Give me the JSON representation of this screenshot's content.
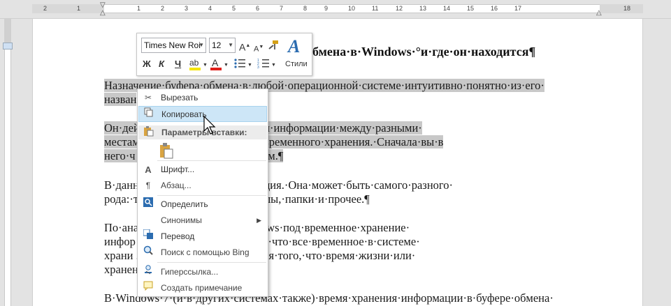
{
  "ruler": {
    "numbers": [
      "2",
      "1",
      "1",
      "2",
      "3",
      "4",
      "5",
      "6",
      "7",
      "8",
      "9",
      "10",
      "11",
      "12",
      "13",
      "14",
      "15",
      "16",
      "17",
      "18"
    ]
  },
  "document": {
    "heading_visible": "обмена·в·Windows·°и·где·он·находится¶",
    "lines": [
      {
        "text": "Назначение·буфера·обмена·в·любой·операционной·системе·интуитивно·понятно·из·его·",
        "selected": true
      },
      {
        "text": "назван",
        "selected": true
      },
      {
        "text": "Он·дей                                       обмена·или·перемещения·информации·между·разными·",
        "selected": true
      },
      {
        "text": "местам                                   пьютере.·Это·как·склад·временного·хранения.·Сначала·вы·в",
        "selected": true
      },
      {
        "text": "него·ч                                          раздаете·по·разным·местам.¶",
        "selected": true
      },
      {
        "text": "В·данн                                     на·загружается·информация.·Она·может·быть·самого·разного·",
        "selected": false
      },
      {
        "text": "рода:·т                                       ых·форматов,·целые·файлы,·папки·и·прочее.¶",
        "selected": false
      },
      {
        "text": "По·ана                                      ационной·системе·Windows·под·временное·хранение·",
        "selected": false
      },
      {
        "text": "инфор                                       альная·область.·Известно,·что·все·временное·в·системе·",
        "selected": false
      },
      {
        "text": "храни                                         .·Это·важно·для·понимания·того,·что·время·жизни·или·",
        "selected": false
      },
      {
        "text": "хранен                                       ено.¶",
        "selected": false
      },
      {
        "text": "В·Windows·7·(и·в·других·системах·также)·время·хранения·информации·в·буфере·обмена·",
        "selected": false
      }
    ]
  },
  "mini_toolbar": {
    "font_name": "Times New Roi",
    "font_size": "12",
    "grow_font": "A",
    "shrink_font": "A",
    "bold": "Ж",
    "italic": "К",
    "underline": "Ч",
    "styles_label": "Стили"
  },
  "context_menu": {
    "items": [
      {
        "label": "Вырезать",
        "icon": "scissors-icon"
      },
      {
        "label": "Копировать",
        "icon": "copy-icon",
        "hover": true
      },
      {
        "label": "Параметры вставки:",
        "icon": "paste-icon",
        "header": true
      },
      {
        "label": "Шрифт...",
        "icon": "font-icon"
      },
      {
        "label": "Абзац...",
        "icon": "paragraph-icon"
      },
      {
        "label": "Определить",
        "icon": "define-icon"
      },
      {
        "label": "Синонимы",
        "icon": "",
        "submenu": true
      },
      {
        "label": "Перевод",
        "icon": "translate-icon"
      },
      {
        "label": "Поиск с помощью Bing",
        "icon": "bing-search-icon"
      },
      {
        "label": "Гиперссылка...",
        "icon": "hyperlink-icon"
      },
      {
        "label": "Создать примечание",
        "icon": "comment-icon"
      }
    ]
  },
  "colors": {
    "selection": "#c8c8c8",
    "hover": "#cde6f7",
    "highlight_yellow": "#f5e400",
    "font_red": "#e0201b",
    "styles_blue": "#2b6cb0"
  }
}
